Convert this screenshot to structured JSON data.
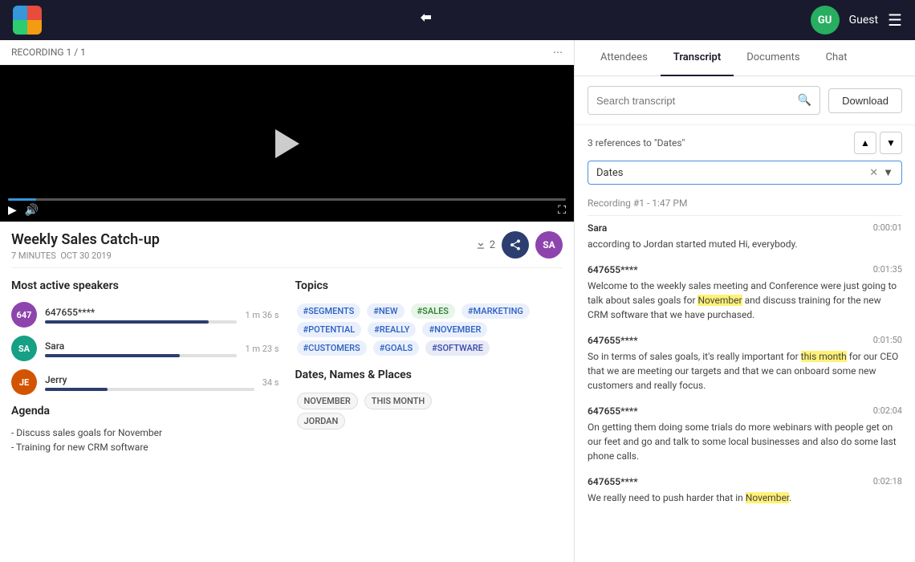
{
  "nav": {
    "logo_label": "App Logo",
    "guest_label": "Guest",
    "avatar_text": "GU"
  },
  "recording": {
    "label": "RECORDING 1 / 1",
    "more_icon": "⋯"
  },
  "meeting": {
    "title": "Weekly Sales Catch-up",
    "duration": "7 MINUTES",
    "date": "OCT 30 2019",
    "download_count": "2",
    "share_avatar": "SA"
  },
  "speakers_section": {
    "title": "Most active speakers",
    "speakers": [
      {
        "id": "647",
        "name": "647655****",
        "time": "1 m 36 s",
        "bar_pct": "85",
        "color": "purple"
      },
      {
        "id": "SA",
        "name": "Sara",
        "time": "1 m 23 s",
        "bar_pct": "70",
        "color": "teal"
      },
      {
        "id": "JE",
        "name": "Jerry",
        "time": "34 s",
        "bar_pct": "30",
        "color": "orange"
      }
    ]
  },
  "topics_section": {
    "title": "Topics",
    "tags": [
      "#SEGMENTS",
      "#NEW",
      "#SALES",
      "#MARKETING",
      "#POTENTIAL",
      "#REALLY",
      "#NOVEMBER",
      "#CUSTOMERS",
      "#GOALS",
      "#SOFTWARE"
    ]
  },
  "dates_section": {
    "title": "Dates, Names & Places",
    "tags": [
      "NOVEMBER",
      "THIS MONTH",
      "JORDAN"
    ]
  },
  "agenda_section": {
    "title": "Agenda",
    "items": [
      "- Discuss sales goals for November",
      "- Training for new CRM software"
    ]
  },
  "transcript_panel": {
    "tabs": [
      "Attendees",
      "Transcript",
      "Documents",
      "Chat"
    ],
    "active_tab": "Transcript",
    "search_placeholder": "Search transcript",
    "download_label": "Download",
    "references_text": "3 references to \"Dates\"",
    "filter_value": "Dates",
    "recording_label": "Recording #1 - 1:47 PM",
    "entries": [
      {
        "speaker": "Sara",
        "time": "0:00:01",
        "text": "according to Jordan started muted Hi, everybody.",
        "highlights": []
      },
      {
        "speaker": "647655****",
        "time": "0:01:35",
        "text": "Welcome to the weekly sales meeting and Conference were just going to talk about sales goals for November and discuss training for the new CRM software that we have purchased.",
        "highlights": [
          {
            "word": "November",
            "type": "yellow"
          }
        ]
      },
      {
        "speaker": "647655****",
        "time": "0:01:50",
        "text": "So in terms of sales goals, it's really important for this month for our CEO that we are meeting our targets and that we can onboard some new customers and really focus.",
        "highlights": [
          {
            "word": "this month",
            "type": "yellow"
          }
        ]
      },
      {
        "speaker": "647655****",
        "time": "0:02:04",
        "text": "On getting them doing some trials do more webinars with people get on our feet and go and talk to some local businesses and also do some last phone calls.",
        "highlights": []
      },
      {
        "speaker": "647655****",
        "time": "0:02:18",
        "text": "We really need to push harder that in November.",
        "highlights": [
          {
            "word": "November",
            "type": "yellow"
          }
        ]
      }
    ]
  }
}
